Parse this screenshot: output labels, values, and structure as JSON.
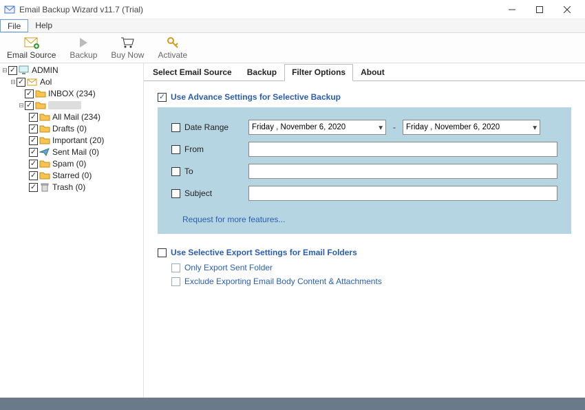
{
  "window": {
    "title": "Email Backup Wizard v11.7 (Trial)"
  },
  "menu": {
    "file": "File",
    "help": "Help"
  },
  "toolbar": {
    "emailSource": "Email Source",
    "backup": "Backup",
    "buyNow": "Buy Now",
    "activate": "Activate"
  },
  "tree": {
    "root": "ADMIN",
    "account": "Aol",
    "inbox": "INBOX (234)",
    "folders": [
      {
        "label": "All Mail (234)"
      },
      {
        "label": "Drafts (0)"
      },
      {
        "label": "Important (20)"
      },
      {
        "label": "Sent Mail (0)"
      },
      {
        "label": "Spam (0)"
      },
      {
        "label": "Starred (0)"
      },
      {
        "label": "Trash (0)"
      }
    ]
  },
  "tabs": {
    "source": "Select Email Source",
    "backup": "Backup",
    "filter": "Filter Options",
    "about": "About"
  },
  "filters": {
    "advance": "Use Advance Settings for Selective Backup",
    "dateRange": "Date Range",
    "dateFrom": "Friday   ,  November   6, 2020",
    "dateTo": "Friday   ,  November   6, 2020",
    "from": "From",
    "to": "To",
    "subject": "Subject",
    "request": "Request for more features...",
    "selective": "Use Selective Export Settings for Email Folders",
    "onlySent": "Only Export Sent Folder",
    "excludeBody": "Exclude Exporting Email Body Content & Attachments"
  }
}
